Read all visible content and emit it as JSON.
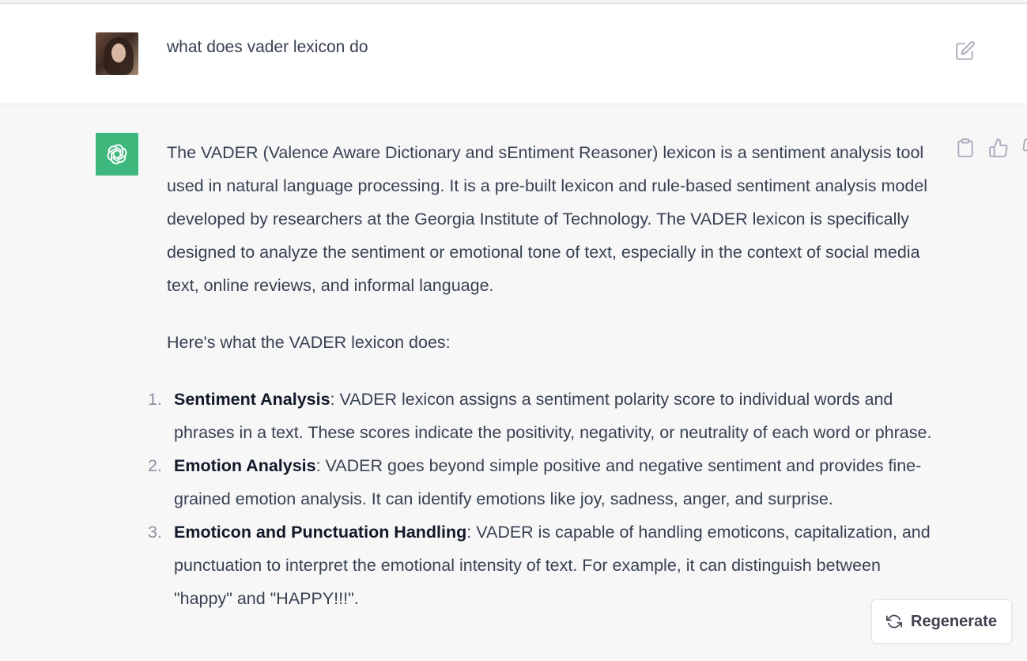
{
  "user_message": {
    "text": "what does vader lexicon do"
  },
  "assistant_message": {
    "paragraph": "The VADER (Valence Aware Dictionary and sEntiment Reasoner) lexicon is a sentiment analysis tool used in natural language processing. It is a pre-built lexicon and rule-based sentiment analysis model developed by researchers at the Georgia Institute of Technology. The VADER lexicon is specifically designed to analyze the sentiment or emotional tone of text, especially in the context of social media text, online reviews, and informal language.",
    "intro": "Here's what the VADER lexicon does:",
    "items": [
      {
        "num": "1.",
        "title": "Sentiment Analysis",
        "text": ": VADER lexicon assigns a sentiment polarity score to individual words and phrases in a text. These scores indicate the positivity, negativity, or neutrality of each word or phrase."
      },
      {
        "num": "2.",
        "title": "Emotion Analysis",
        "text": ": VADER goes beyond simple positive and negative sentiment and provides fine-grained emotion analysis. It can identify emotions like joy, sadness, anger, and surprise."
      },
      {
        "num": "3.",
        "title": "Emoticon and Punctuation Handling",
        "text": ": VADER is capable of handling emoticons, capitalization, and punctuation to interpret the emotional intensity of text. For example, it can distinguish between \"happy\" and \"HAPPY!!!\"."
      }
    ]
  },
  "regenerate": {
    "label": "Regenerate"
  },
  "icons": {
    "edit": "edit-icon",
    "copy": "clipboard-icon",
    "thumbs_up": "thumbs-up-icon",
    "thumbs_down": "thumbs-down-icon",
    "refresh": "refresh-icon",
    "assistant_logo": "openai-logo-icon"
  },
  "colors": {
    "assistant_avatar_bg": "#3eb77c",
    "page_bg": "#f7f7f8",
    "user_bg": "#ffffff"
  }
}
